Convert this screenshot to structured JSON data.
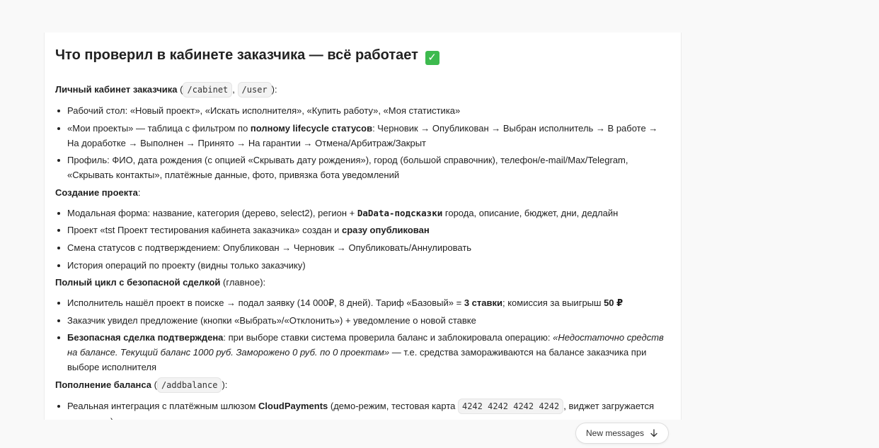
{
  "message": {
    "heading": "Что проверил в кабинете заказчика — всё работает",
    "heading_emoji": "✓",
    "sections": [
      {
        "title": "Личный кабинет заказчика",
        "title_prefix": " (",
        "codes": [
          "/cabinet",
          "/user"
        ],
        "title_suffix": "):",
        "items": [
          {
            "text": "Рабочий стол: «Новый проект», «Искать исполнителя», «Купить работу», «Моя статистика»"
          },
          {
            "pre": "«Мои проекты» — таблица с фильтром по ",
            "bold": "полному lifecycle статусов",
            "post": ": Черновик → Опубликован → Выбран исполнитель → В работе → На доработке → Выполнен → Принято → На гарантии → Отмена/Арбитраж/Закрыт"
          },
          {
            "text": "Профиль: ФИО, дата рождения (с опцией «Скрывать дату рождения»), город (большой справочник), телефон/e-mail/Max/Telegram, «Скрывать контакты», платёжные данные, фото, привязка бота уведомлений"
          }
        ]
      },
      {
        "title": "Создание проекта",
        "title_suffix": ":",
        "items": [
          {
            "pre": "Модальная форма: название, категория (дерево, select2), регион + ",
            "bold": "DaData-подсказки",
            "post": " города, описание, бюджет, дни, дедлайн"
          },
          {
            "pre": "Проект «tst Проект тестирования кабинета заказчика» создан и ",
            "bold": "сразу опубликован",
            "post": ""
          },
          {
            "text": "Смена статусов с подтверждением: Опубликован → Черновик → Опубликовать/Аннулировать"
          },
          {
            "text": "История операций по проекту (видны только заказчику)"
          }
        ]
      },
      {
        "title": "Полный цикл с безопасной сделкой",
        "title_suffix": " (главное):",
        "items": [
          {
            "pre": "Исполнитель нашёл проект в поиске → подал заявку (14 000₽, 8 дней). Тариф «Базовый» = ",
            "bold": "3 ставки",
            "mid": "; комиссия за выигрыш ",
            "bold2": "50 ₽"
          },
          {
            "text": "Заказчик увидел предложение (кнопки «Выбрать»/«Отклонить») + уведомление о новой ставке"
          },
          {
            "bold": "Безопасная сделка подтверждена",
            "mid": ": при выборе ставки система проверила баланс и заблокировала операцию: ",
            "italic": "«Недостаточно средств на балансе. Текущий баланс 1000 руб. Заморожено 0 руб. по 0 проектам»",
            "post": " — т.е. средства замораживаются на балансе заказчика при выборе исполнителя"
          }
        ]
      },
      {
        "title": "Пополнение баланса",
        "title_prefix": " (",
        "code": "/addbalance",
        "title_suffix": "):",
        "items": [
          {
            "pre": "Реальная интеграция с платёжным шлюзом ",
            "bold": "CloudPayments",
            "mid": " (демо-режим, тестовая карта ",
            "code": "4242 4242 4242 4242",
            "post": ", виджет загружается корректно)"
          }
        ]
      }
    ]
  },
  "new_messages_button": {
    "label": "New messages"
  }
}
